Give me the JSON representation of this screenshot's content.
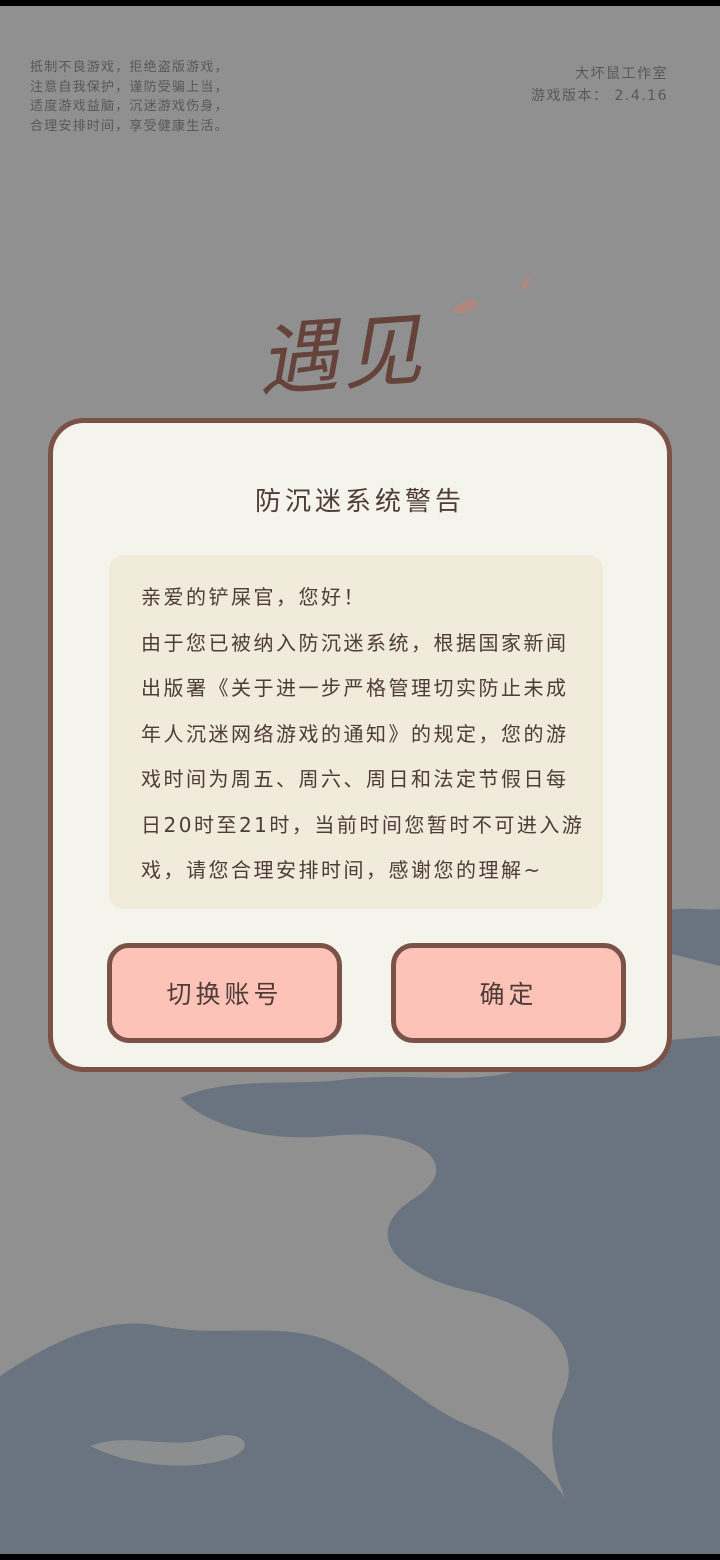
{
  "health_notice": [
    "抵制不良游戏，拒绝盗版游戏，",
    "注意自我保护，谨防受骗上当，",
    "适度游戏益脑，沉迷游戏伤身，",
    "合理安排时间，享受健康生活。"
  ],
  "studio": {
    "name": "大坏鼠工作室",
    "version": "游戏版本： 2.4.16"
  },
  "logo": {
    "title": "遇见"
  },
  "dialog": {
    "title": "防沉迷系统警告",
    "message_lines": [
      "亲爱的铲屎官，您好！",
      "由于您已被纳入防沉迷系统，根据国家新闻",
      "出版署《关于进一步严格管理切实防止未成",
      "年人沉迷网络游戏的通知》的规定，您的游",
      "戏时间为周五、周六、周日和法定节假日每",
      "日20时至21时，当前时间您暂时不可进入游",
      "戏，请您合理安排时间，感谢您的理解~"
    ],
    "switch_account_label": "切换账号",
    "confirm_label": "确定"
  },
  "colors": {
    "background": "#a3a3a3",
    "dialog_bg": "#f5f4ec",
    "dialog_border": "#7b5248",
    "message_bg": "#f0ebdb",
    "button_bg": "#fdc3b8",
    "text": "#4e3c36",
    "water": "#75808f"
  }
}
